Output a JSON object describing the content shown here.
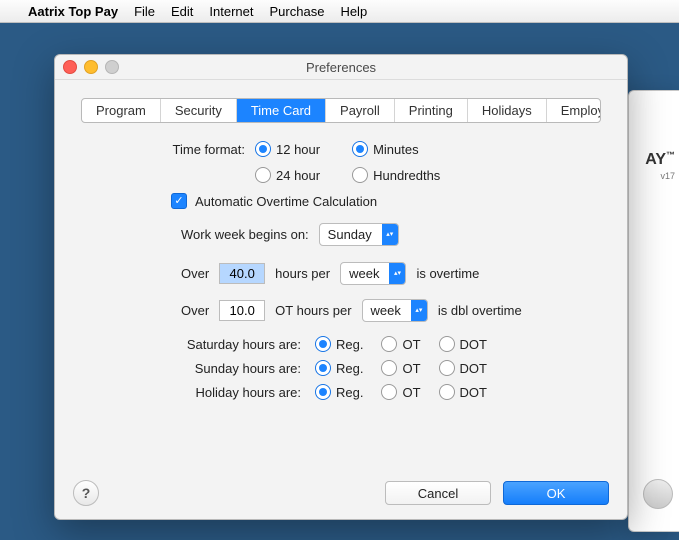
{
  "menubar": {
    "app": "Aatrix Top Pay",
    "items": [
      "File",
      "Edit",
      "Internet",
      "Purchase",
      "Help"
    ]
  },
  "background": {
    "title": "AY",
    "tm": "™",
    "ver": "v17"
  },
  "window": {
    "title": "Preferences"
  },
  "tabs": [
    "Program",
    "Security",
    "Time Card",
    "Payroll",
    "Printing",
    "Holidays",
    "Employees"
  ],
  "active_tab": "Time Card",
  "form": {
    "time_format_label": "Time format:",
    "tf_col1": {
      "a": "12 hour",
      "b": "24 hour"
    },
    "tf_col2": {
      "a": "Minutes",
      "b": "Hundredths"
    },
    "auto_ot_label": "Automatic Overtime Calculation",
    "week_begins_label": "Work week begins on:",
    "week_begins_value": "Sunday",
    "over1_pre": "Over",
    "over1_val": "40.0",
    "over1_mid": "hours per",
    "over1_unit": "week",
    "over1_post": "is overtime",
    "over2_pre": "Over",
    "over2_val": "10.0",
    "over2_mid": "OT hours per",
    "over2_unit": "week",
    "over2_post": "is dbl overtime",
    "hour_rows": [
      {
        "label": "Saturday hours are:",
        "opts": [
          "Reg.",
          "OT",
          "DOT"
        ],
        "sel": 0
      },
      {
        "label": "Sunday hours are:",
        "opts": [
          "Reg.",
          "OT",
          "DOT"
        ],
        "sel": 0
      },
      {
        "label": "Holiday hours are:",
        "opts": [
          "Reg.",
          "OT",
          "DOT"
        ],
        "sel": 0
      }
    ]
  },
  "footer": {
    "help": "?",
    "cancel": "Cancel",
    "ok": "OK"
  }
}
